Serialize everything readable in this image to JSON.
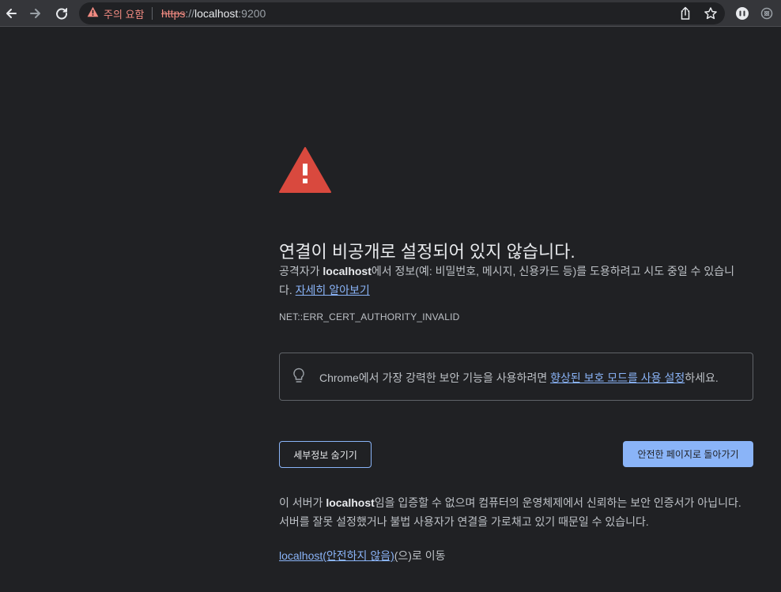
{
  "toolbar": {
    "security_chip_label": "주의 요함",
    "url_scheme": "https",
    "url_separator": "://",
    "url_host": "localhost",
    "url_port": ":9200",
    "icons": [
      "back-arrow-icon",
      "forward-arrow-icon",
      "reload-icon",
      "warning-icon",
      "share-icon",
      "bookmark-star-icon",
      "profile-icon",
      "extension-icon"
    ]
  },
  "interstitial": {
    "heading": "연결이 비공개로 설정되어 있지 않습니다.",
    "description_prefix": "공격자가 ",
    "description_host": "localhost",
    "description_suffix": "에서 정보(예: 비밀번호, 메시지, 신용카드 등)를 도용하려고 시도 중일 수 있습니다. ",
    "learn_more_link": "자세히 알아보기",
    "error_code": "NET::ERR_CERT_AUTHORITY_INVALID",
    "safe_browsing_prefix": "Chrome에서 가장 강력한 보안 기능을 사용하려면 ",
    "safe_browsing_link": "향상된 보호 모드를 사용 설정",
    "safe_browsing_suffix": "하세요.",
    "hide_details_button": "세부정보 숨기기",
    "back_to_safety_button": "안전한 페이지로 돌아가기",
    "details_prefix": "이 서버가 ",
    "details_host": "localhost",
    "details_suffix": "임을 입증할 수 없으며 컴퓨터의 운영체제에서 신뢰하는 보안 인증서가 아닙니다. 서버를 잘못 설정했거나 불법 사용자가 연결을 가로채고 있기 때문일 수 있습니다.",
    "proceed_link": "localhost(안전하지 않음)",
    "proceed_suffix": "(으)로 이동"
  },
  "colors": {
    "background": "#202124",
    "toolbar": "#35363a",
    "warning_red": "#d9493e",
    "link_blue": "#8ab4f8",
    "insecure_red": "#f28b82"
  }
}
